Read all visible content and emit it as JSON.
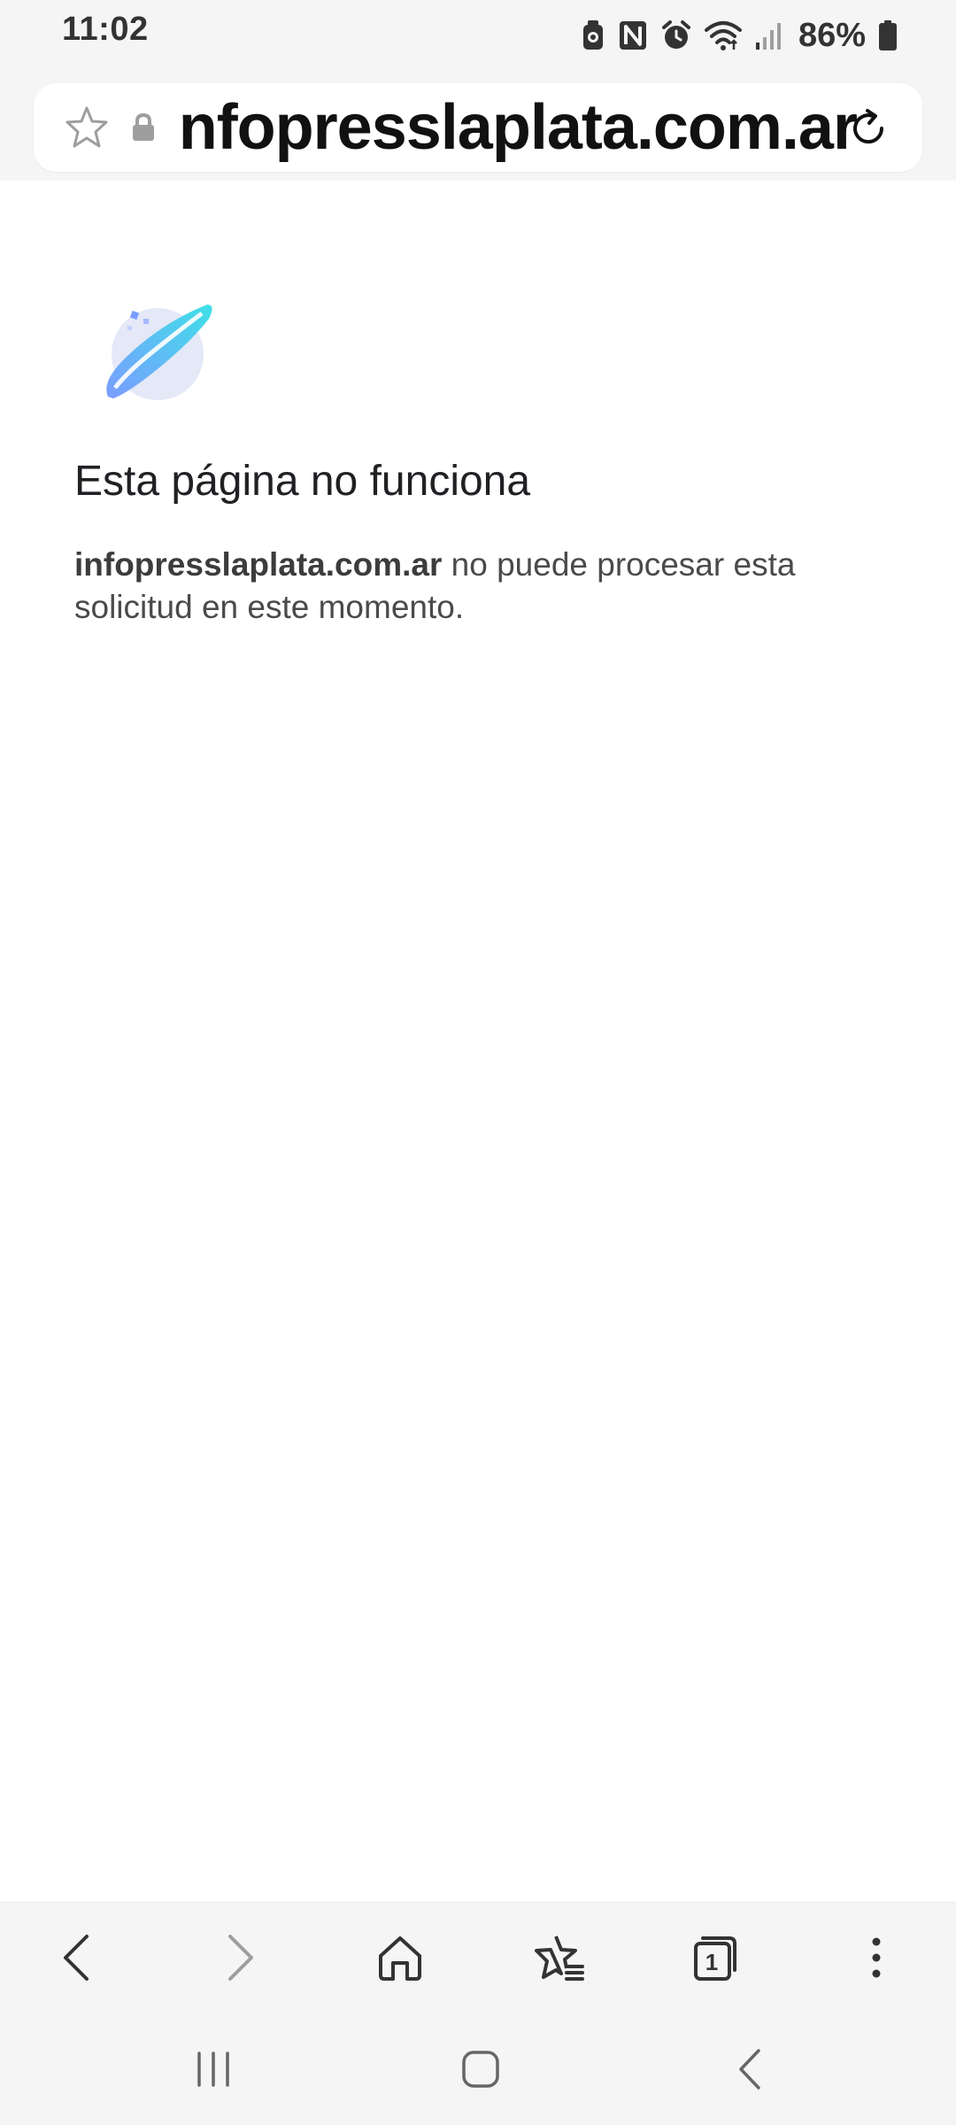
{
  "status_bar": {
    "time": "11:02",
    "battery_percent": "86%",
    "icons": [
      "sim-manager-icon",
      "nfc-icon",
      "alarm-icon",
      "wifi-icon",
      "signal-icon",
      "battery-icon"
    ]
  },
  "url_bar": {
    "url": "infopresslaplata.com.ar",
    "icons": [
      "star-icon",
      "lock-icon",
      "reload-icon"
    ]
  },
  "error_page": {
    "title": "Esta página no funciona",
    "domain": "infopresslaplata.com.ar",
    "message": " no puede procesar esta solicitud en este momento."
  },
  "toolbar": {
    "tabs_count": "1",
    "icons": [
      "back-icon",
      "forward-icon",
      "home-icon",
      "bookmarks-icon",
      "tabs-icon",
      "more-icon"
    ]
  },
  "nav_bar": {
    "icons": [
      "recents-icon",
      "home-nav-icon",
      "back-nav-icon"
    ]
  },
  "colors": {
    "chrome_bg": "#f5f5f5",
    "page_bg": "#ffffff",
    "text_primary": "#202124",
    "text_secondary": "#4a4a4a",
    "icon_gray": "#333333",
    "icon_disabled": "#9e9e9e"
  }
}
